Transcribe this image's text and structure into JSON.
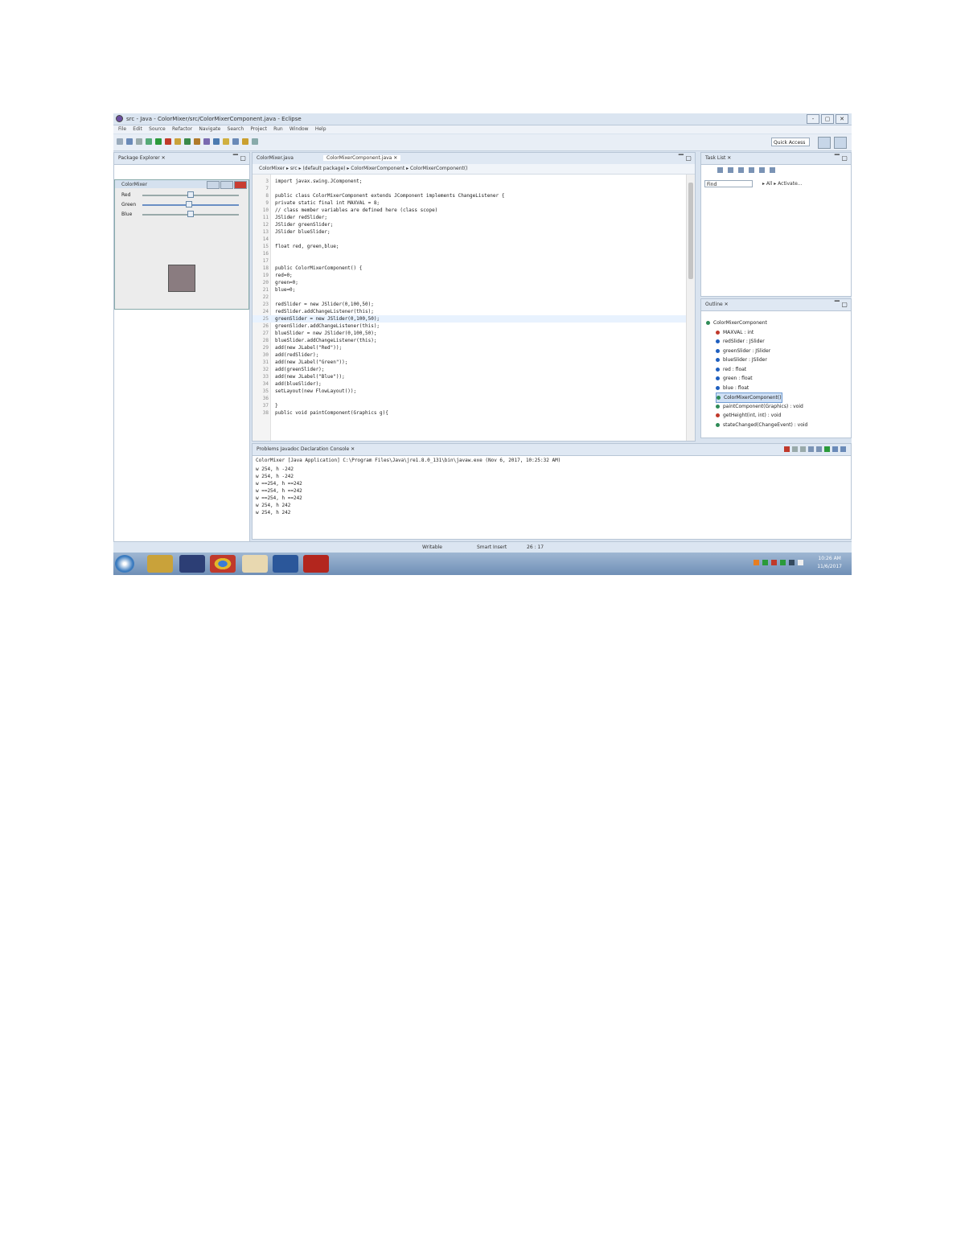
{
  "window": {
    "title": "src - Java - ColorMixer/src/ColorMixerComponent.java - Eclipse",
    "controls": [
      "-",
      "▢",
      "✕"
    ]
  },
  "menu": [
    "File",
    "Edit",
    "Source",
    "Refactor",
    "Navigate",
    "Search",
    "Project",
    "Run",
    "Window",
    "Help"
  ],
  "toolbar": {
    "quick_access": "Quick Access"
  },
  "package_explorer": {
    "tab": "Package Explorer ✕"
  },
  "swing_window": {
    "title": "ColorMixer",
    "sliders": [
      {
        "label": "Red",
        "level": 0.5
      },
      {
        "label": "Green",
        "level": 0.48
      },
      {
        "label": "Blue",
        "level": 0.5
      }
    ],
    "swatch_color": "#8a7c80"
  },
  "editor": {
    "tabs": [
      "ColorMixer.java",
      "ColorMixerComponent.java ✕"
    ],
    "breadcrumb": "ColorMixer ▸ src ▸ (default package) ▸ ColorMixerComponent ▸ ColorMixerComponent()",
    "lines": [
      {
        "n": "3",
        "t": "import javax.swing.JComponent;"
      },
      {
        "n": "7",
        "t": ""
      },
      {
        "n": "8",
        "t": "public class ColorMixerComponent extends JComponent implements ChangeListener {"
      },
      {
        "n": "9",
        "t": "    private static final int MAXVAL = 8;"
      },
      {
        "n": "10",
        "t": "    // class member variables are defined here (class scope)"
      },
      {
        "n": "11",
        "t": "    JSlider redSlider;"
      },
      {
        "n": "12",
        "t": "    JSlider greenSlider;"
      },
      {
        "n": "13",
        "t": "    JSlider blueSlider;"
      },
      {
        "n": "14",
        "t": ""
      },
      {
        "n": "15",
        "t": "    float red, green,blue;"
      },
      {
        "n": "16",
        "t": ""
      },
      {
        "n": "17",
        "t": ""
      },
      {
        "n": "18",
        "t": "    public ColorMixerComponent() {"
      },
      {
        "n": "19",
        "t": "        red=0;"
      },
      {
        "n": "20",
        "t": "        green=0;"
      },
      {
        "n": "21",
        "t": "        blue=0;"
      },
      {
        "n": "22",
        "t": ""
      },
      {
        "n": "23",
        "t": "        redSlider = new JSlider(0,100,50);"
      },
      {
        "n": "24",
        "t": "        redSlider.addChangeListener(this);"
      },
      {
        "n": "25",
        "t": "        greenSlider = new JSlider(0,100,50);"
      },
      {
        "n": "26",
        "t": "        greenSlider.addChangeListener(this);"
      },
      {
        "n": "27",
        "t": "        blueSlider = new JSlider(0,100,50);"
      },
      {
        "n": "28",
        "t": "        blueSlider.addChangeListener(this);"
      },
      {
        "n": "29",
        "t": "        add(new JLabel(\"Red\"));"
      },
      {
        "n": "30",
        "t": "        add(redSlider);"
      },
      {
        "n": "31",
        "t": "        add(new JLabel(\"Green\"));"
      },
      {
        "n": "32",
        "t": "        add(greenSlider);"
      },
      {
        "n": "33",
        "t": "        add(new JLabel(\"Blue\"));"
      },
      {
        "n": "34",
        "t": "        add(blueSlider);"
      },
      {
        "n": "35",
        "t": "        setLayout(new FlowLayout());"
      },
      {
        "n": "36",
        "t": ""
      },
      {
        "n": "37",
        "t": "    }"
      },
      {
        "n": "38",
        "t": "    public void paintComponent(Graphics g){"
      }
    ],
    "highlight_line": 19
  },
  "task_list": {
    "tab": "Task List ✕",
    "find_placeholder": "Find",
    "filters": "▸ All ▸ Activate..."
  },
  "outline": {
    "tab": "Outline ✕",
    "items": [
      {
        "text": "ColorMixerComponent",
        "color": "#2e8b57"
      },
      {
        "text": "MAXVAL : int",
        "color": "#c0392b"
      },
      {
        "text": "redSlider : JSlider",
        "color": "#1f5fbf"
      },
      {
        "text": "greenSlider : JSlider",
        "color": "#1f5fbf"
      },
      {
        "text": "blueSlider : JSlider",
        "color": "#1f5fbf"
      },
      {
        "text": "red : float",
        "color": "#1f5fbf"
      },
      {
        "text": "green : float",
        "color": "#1f5fbf"
      },
      {
        "text": "blue : float",
        "color": "#1f5fbf"
      },
      {
        "text": "ColorMixerComponent()",
        "color": "#2e8b57"
      },
      {
        "text": "paintComponent(Graphics) : void",
        "color": "#2e8b57"
      },
      {
        "text": "getHeight(int, int) : void",
        "color": "#c0392b"
      },
      {
        "text": "stateChanged(ChangeEvent) : void",
        "color": "#2e8b57"
      }
    ],
    "selected": 8
  },
  "console": {
    "tabs": "Problems  Javadoc  Declaration  Console ✕",
    "header": "ColorMixer [Java Application] C:\\Program Files\\Java\\jre1.8.0_131\\bin\\javaw.exe (Nov 6, 2017, 10:25:32 AM)",
    "lines": [
      "w   254, h  -242",
      "w   254, h  -242",
      "w ==254, h ==242",
      "w ==254, h ==242",
      "w ==254, h ==242",
      "w   254, h   242",
      "w   254, h   242"
    ]
  },
  "status": {
    "mode": "Writable",
    "insert": "Smart Insert",
    "position": "26 : 17"
  },
  "taskbar": {
    "clock_time": "10:26 AM",
    "clock_date": "11/6/2017"
  }
}
